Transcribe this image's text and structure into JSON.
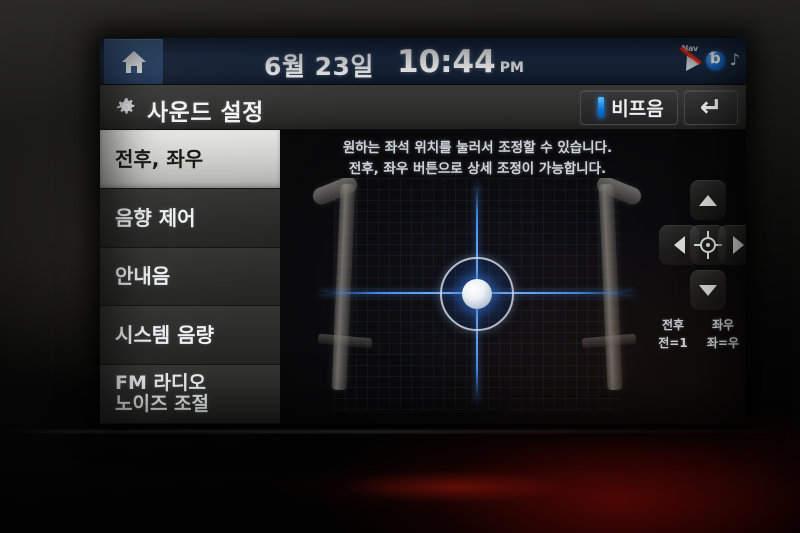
{
  "status_bar": {
    "home_icon": "home-icon",
    "date": "6월 23일",
    "time": "10:44",
    "ampm": "PM",
    "nav_icon_label": "Nav",
    "nav_icon": "nav-disabled-icon",
    "bluetooth_icon": "bluetooth-icon",
    "music_note_icon": "music-note-icon"
  },
  "title_bar": {
    "gear_icon": "gear-icon",
    "title": "사운드 설정",
    "beep_label": "비프음",
    "beep_indicator_color": "#1d8ce8",
    "back_icon": "back-arrow-icon"
  },
  "sidebar": {
    "items": [
      {
        "label": "전후, 좌우",
        "selected": true
      },
      {
        "label": "음향 제어",
        "selected": false
      },
      {
        "label": "안내음",
        "selected": false
      },
      {
        "label": "시스템 음량",
        "selected": false
      },
      {
        "label": "FM 라디오\n노이즈 조절",
        "selected": false
      }
    ]
  },
  "main": {
    "instruction_line1": "원하는 좌석 위치를 눌러서 조정할 수 있습니다.",
    "instruction_line2": "전후, 좌우 버튼으로 상세 조정이 가능합니다.",
    "dpad": {
      "up": "up-arrow-icon",
      "down": "down-arrow-icon",
      "left": "left-arrow-icon",
      "right": "right-arrow-icon",
      "center": "center-target-icon"
    },
    "readouts": [
      {
        "title": "전후",
        "value": "전=1"
      },
      {
        "title": "좌우",
        "value": "좌=우"
      }
    ]
  },
  "theme": {
    "accent_blue": "#1d8ce8",
    "status_bar_blue": "#1b2d48",
    "selected_item_bg": "#d2d2cf"
  }
}
